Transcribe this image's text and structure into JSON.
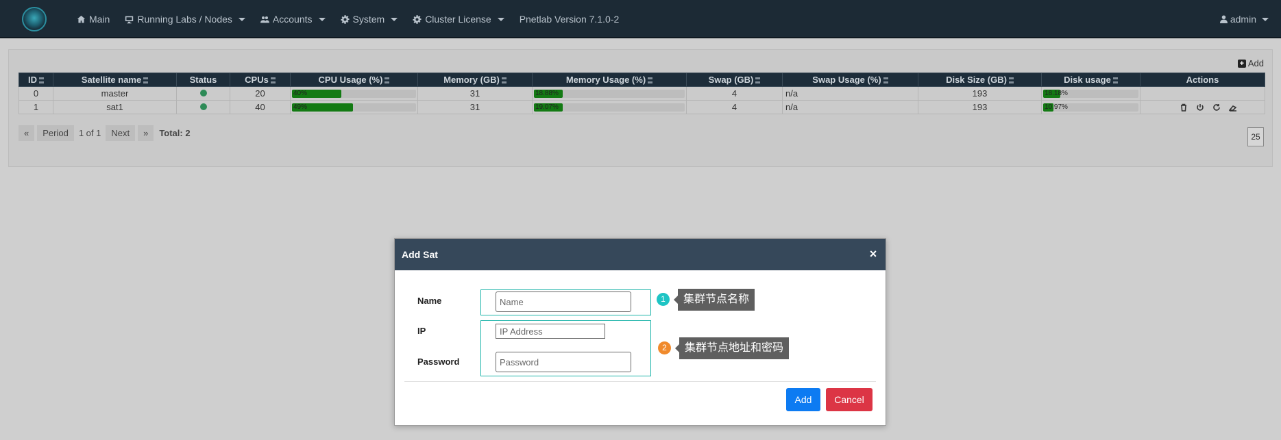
{
  "nav": {
    "items": [
      {
        "label": "Main",
        "icon": "home-icon",
        "caret": false
      },
      {
        "label": "Running Labs / Nodes",
        "icon": "monitor-icon",
        "caret": true
      },
      {
        "label": "Accounts",
        "icon": "users-icon",
        "caret": true
      },
      {
        "label": "System",
        "icon": "gear-icon",
        "caret": true
      },
      {
        "label": "Cluster License",
        "icon": "gear-icon",
        "caret": true
      },
      {
        "label": "Pnetlab Version 7.1.0-2",
        "icon": "",
        "caret": false
      }
    ],
    "user": "admin"
  },
  "panel": {
    "add_label": "Add"
  },
  "table": {
    "headers": [
      "ID",
      "Satellite name",
      "Status",
      "CPUs",
      "CPU Usage (%)",
      "Memory (GB)",
      "Memory Usage (%)",
      "Swap (GB)",
      "Swap Usage (%)",
      "Disk Size (GB)",
      "Disk usage",
      "Actions"
    ],
    "rows": [
      {
        "id": "0",
        "name": "master",
        "status": "online",
        "cpus": "20",
        "cpu_usage": 40,
        "cpu_label": "40%",
        "memory": "31",
        "mem_usage": 18.88,
        "mem_label": "18.88%",
        "swap": "4",
        "swap_usage": "n/a",
        "disk": "193",
        "disk_usage": 18.18,
        "disk_label": "18.18%"
      },
      {
        "id": "1",
        "name": "sat1",
        "status": "online",
        "cpus": "40",
        "cpu_usage": 49,
        "cpu_label": "49%",
        "memory": "31",
        "mem_usage": 19.07,
        "mem_label": "19.07%",
        "swap": "4",
        "swap_usage": "n/a",
        "disk": "193",
        "disk_usage": 10.97,
        "disk_label": "10.97%"
      }
    ]
  },
  "pager": {
    "period": "Period",
    "page_info": "1 of 1",
    "next": "Next",
    "total": "Total: 2",
    "per_page": "25"
  },
  "modal": {
    "title": "Add Sat",
    "name_label": "Name",
    "name_placeholder": "Name",
    "ip_label": "IP",
    "ip_placeholder": "IP Address",
    "password_label": "Password",
    "password_placeholder": "Password",
    "add_button": "Add",
    "cancel_button": "Cancel",
    "annotation1_number": "1",
    "annotation1_text": "集群节点名称",
    "annotation2_number": "2",
    "annotation2_text": "集群节点地址和密码"
  },
  "colors": {
    "topbar": "#1c2a35",
    "modal_header": "#36485a",
    "add_button": "#0d7bf2",
    "cancel_button": "#dc3545",
    "highlight": "#1bb3a8",
    "badge1": "#1ec4c4",
    "badge2": "#f08a2c",
    "bar_fill": "#137a13"
  }
}
